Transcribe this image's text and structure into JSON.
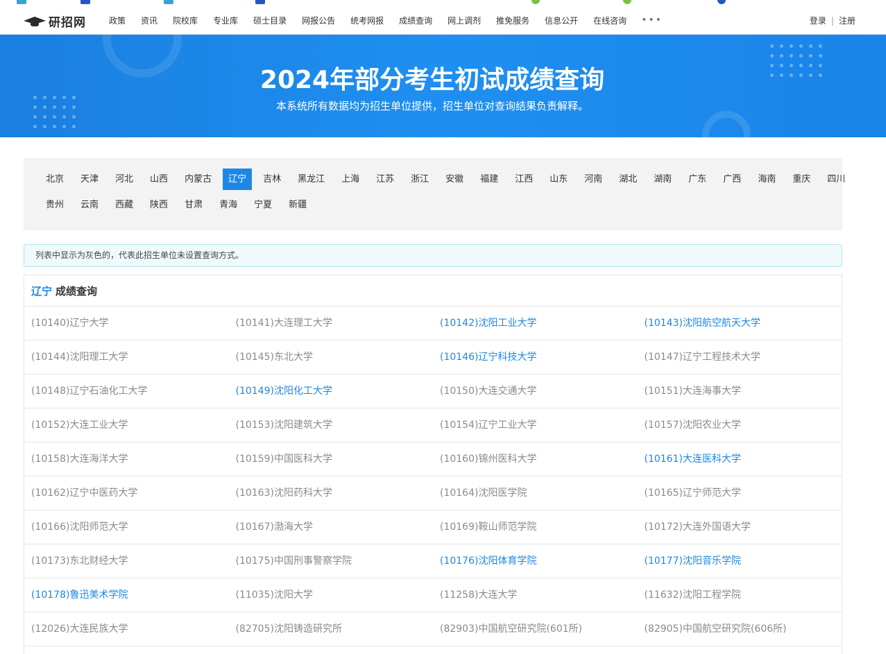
{
  "site": {
    "logo_text": "研招网"
  },
  "nav": {
    "items": [
      "政策",
      "资讯",
      "院校库",
      "专业库",
      "硕士目录",
      "网报公告",
      "统考网报",
      "成绩查询",
      "网上调剂",
      "推免服务",
      "信息公开",
      "在线咨询"
    ],
    "more": "•••",
    "login": "登录",
    "separator": "|",
    "register": "注册"
  },
  "banner": {
    "title": "2024年部分考生初试成绩查询",
    "subtitle": "本系统所有数据均为招生单位提供，招生单位对查询结果负责解释。"
  },
  "provinces": {
    "active": "辽宁",
    "row1": [
      "北京",
      "天津",
      "河北",
      "山西",
      "内蒙古",
      "辽宁",
      "吉林",
      "黑龙江",
      "上海",
      "江苏",
      "浙江",
      "安徽",
      "福建",
      "江西",
      "山东",
      "河南",
      "湖北",
      "湖南",
      "广东",
      "广西",
      "海南",
      "重庆",
      "四川"
    ],
    "row2": [
      "贵州",
      "云南",
      "西藏",
      "陕西",
      "甘肃",
      "青海",
      "宁夏",
      "新疆"
    ]
  },
  "notice": {
    "text": "列表中显示为灰色的，代表此招生单位未设置查询方式。"
  },
  "results": {
    "province": "辽宁",
    "label": "成绩查询",
    "rows": [
      [
        {
          "name": "(10140)辽宁大学",
          "link": false
        },
        {
          "name": "(10141)大连理工大学",
          "link": false
        },
        {
          "name": "(10142)沈阳工业大学",
          "link": true
        },
        {
          "name": "(10143)沈阳航空航天大学",
          "link": true
        }
      ],
      [
        {
          "name": "(10144)沈阳理工大学",
          "link": false
        },
        {
          "name": "(10145)东北大学",
          "link": false
        },
        {
          "name": "(10146)辽宁科技大学",
          "link": true
        },
        {
          "name": "(10147)辽宁工程技术大学",
          "link": false
        }
      ],
      [
        {
          "name": "(10148)辽宁石油化工大学",
          "link": false
        },
        {
          "name": "(10149)沈阳化工大学",
          "link": true
        },
        {
          "name": "(10150)大连交通大学",
          "link": false
        },
        {
          "name": "(10151)大连海事大学",
          "link": false
        }
      ],
      [
        {
          "name": "(10152)大连工业大学",
          "link": false
        },
        {
          "name": "(10153)沈阳建筑大学",
          "link": false
        },
        {
          "name": "(10154)辽宁工业大学",
          "link": false
        },
        {
          "name": "(10157)沈阳农业大学",
          "link": false
        }
      ],
      [
        {
          "name": "(10158)大连海洋大学",
          "link": false
        },
        {
          "name": "(10159)中国医科大学",
          "link": false
        },
        {
          "name": "(10160)锦州医科大学",
          "link": false
        },
        {
          "name": "(10161)大连医科大学",
          "link": true
        }
      ],
      [
        {
          "name": "(10162)辽宁中医药大学",
          "link": false
        },
        {
          "name": "(10163)沈阳药科大学",
          "link": false
        },
        {
          "name": "(10164)沈阳医学院",
          "link": false
        },
        {
          "name": "(10165)辽宁师范大学",
          "link": false
        }
      ],
      [
        {
          "name": "(10166)沈阳师范大学",
          "link": false
        },
        {
          "name": "(10167)渤海大学",
          "link": false
        },
        {
          "name": "(10169)鞍山师范学院",
          "link": false
        },
        {
          "name": "(10172)大连外国语大学",
          "link": false
        }
      ],
      [
        {
          "name": "(10173)东北财经大学",
          "link": false
        },
        {
          "name": "(10175)中国刑事警察学院",
          "link": false
        },
        {
          "name": "(10176)沈阳体育学院",
          "link": true
        },
        {
          "name": "(10177)沈阳音乐学院",
          "link": true
        }
      ],
      [
        {
          "name": "(10178)鲁迅美术学院",
          "link": true
        },
        {
          "name": "(11035)沈阳大学",
          "link": false
        },
        {
          "name": "(11258)大连大学",
          "link": false
        },
        {
          "name": "(11632)沈阳工程学院",
          "link": false
        }
      ],
      [
        {
          "name": "(12026)大连民族大学",
          "link": false
        },
        {
          "name": "(82705)沈阳铸造研究所",
          "link": false
        },
        {
          "name": "(82903)中国航空研究院(601所)",
          "link": false
        },
        {
          "name": "(82905)中国航空研究院(606所)",
          "link": false
        }
      ]
    ]
  },
  "colors": {
    "accent": "#1e87e6",
    "banner": "#1a84e8",
    "disabled_text": "#8a8a8a"
  }
}
